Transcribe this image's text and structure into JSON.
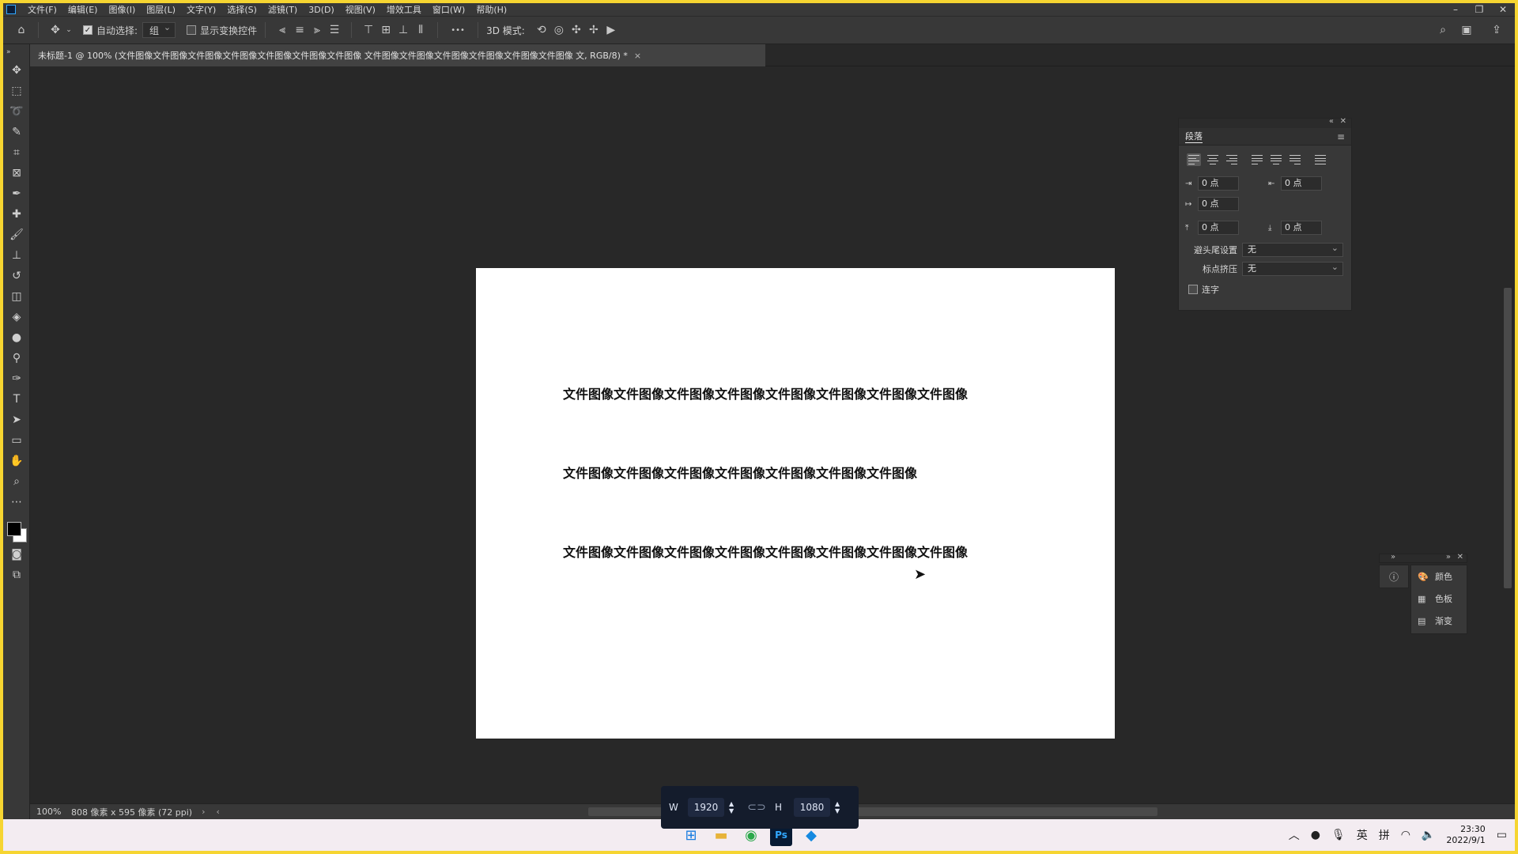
{
  "menubar": {
    "items": [
      "文件(F)",
      "编辑(E)",
      "图像(I)",
      "图层(L)",
      "文字(Y)",
      "选择(S)",
      "滤镜(T)",
      "3D(D)",
      "视图(V)",
      "增效工具",
      "窗口(W)",
      "帮助(H)"
    ]
  },
  "options": {
    "auto_select_label": "自动选择:",
    "auto_select_value": "组",
    "show_transform_label": "显示变换控件",
    "mode_3d_label": "3D 模式:",
    "more_glyph": "•••"
  },
  "document": {
    "tab_title": "未标题-1 @ 100% (文件图像文件图像文件图像文件图像文件图像文件图像文件图像 文件图像文件图像文件图像文件图像文件图像文件图像 文, RGB/8) *",
    "close_glyph": "×",
    "lines": [
      "文件图像文件图像文件图像文件图像文件图像文件图像文件图像文件图像",
      "文件图像文件图像文件图像文件图像文件图像文件图像文件图像",
      "文件图像文件图像文件图像文件图像文件图像文件图像文件图像文件图像"
    ]
  },
  "paragraph_panel": {
    "title": "段落",
    "indent_left": "0 点",
    "indent_right": "0 点",
    "indent_first": "0 点",
    "space_before": "0 点",
    "space_after": "0 点",
    "kinsoku_label": "避头尾设置",
    "kinsoku_value": "无",
    "mojikumi_label": "标点挤压",
    "mojikumi_value": "无",
    "hyphenate_label": "连字"
  },
  "mini_panels": {
    "items": [
      {
        "label": "颜色",
        "icon": "palette-icon"
      },
      {
        "label": "色板",
        "icon": "grid-icon"
      },
      {
        "label": "渐变",
        "icon": "gradient-icon"
      }
    ]
  },
  "status": {
    "zoom": "100%",
    "doc_info": "808 像素 x 595 像素 (72 ppi)"
  },
  "size_popup": {
    "w_label": "W",
    "w_value": "1920",
    "h_label": "H",
    "h_value": "1080"
  },
  "taskbar": {
    "ime_lang": "英",
    "ime_mode": "拼",
    "time": "23:30",
    "date": "2022/9/1",
    "ps_label": "Ps"
  },
  "colors": {
    "frame": "#f6d531",
    "ui_bg": "#383838",
    "workspace_bg": "#282828",
    "canvas_bg": "#ffffff",
    "ps_blue": "#31a8ff"
  }
}
